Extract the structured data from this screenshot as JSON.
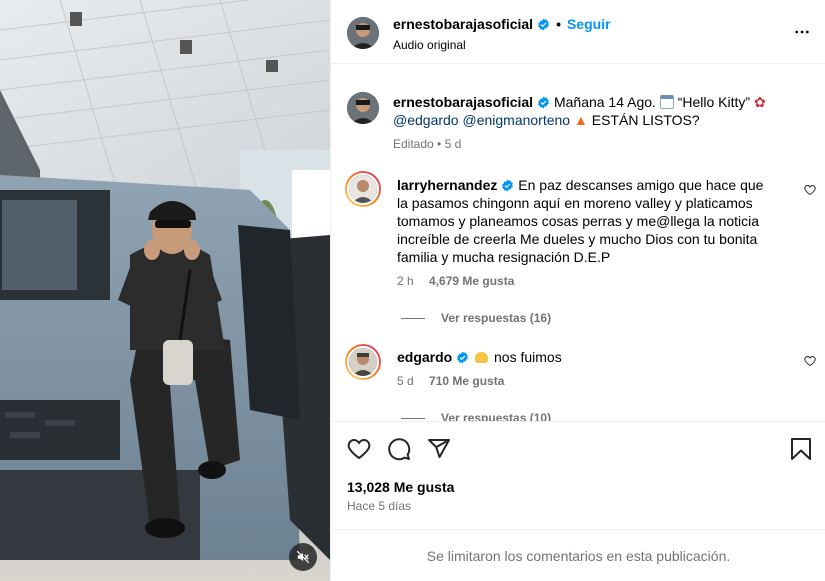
{
  "post": {
    "author": "ernestobarajasoficial",
    "follow_label": "Seguir",
    "audio_label": "Audio original"
  },
  "caption": {
    "author": "ernestobarajasoficial",
    "text_part1": "Mañana 14 Ago.",
    "text_part2": "“Hello Kitty”",
    "mention1": "@edgardo",
    "mention2": "@enigmanorteno",
    "text_part3": "ESTÁN LISTOS?",
    "edited_label": "Editado",
    "time": "5 d"
  },
  "comments": [
    {
      "author": "larryhernandez",
      "text": "En paz descanses amigo que hace que la pasamos chingonn aquí en moreno valley y platicamos tomamos y planeamos cosas perras y me@llega la noticia increíble de creerla Me dueles y mucho Dios con tu bonita familia y mucha resignación D.E.P",
      "time": "2 h",
      "likes": "4,679 Me gusta",
      "replies_label": "Ver respuestas (16)"
    },
    {
      "author": "edgardo",
      "text": "nos fuimos",
      "time": "5 d",
      "likes": "710 Me gusta",
      "replies_label": "Ver respuestas (10)"
    }
  ],
  "stats": {
    "likes": "13,028 Me gusta",
    "posted": "Hace 5 días"
  },
  "footer": {
    "limited_notice": "Se limitaron los comentarios en esta publicación."
  },
  "icons": {
    "like": "heart-icon",
    "comment": "comment-icon",
    "share": "share-icon",
    "save": "bookmark-icon",
    "more": "more-options-icon",
    "mute": "muted-speaker-icon",
    "verified": "verified-badge-icon",
    "calendar": "calendar-emoji",
    "rose": "rose-emoji",
    "fire": "fire-emoji",
    "pray": "raised-hands-emoji"
  },
  "colors": {
    "accent": "#0095f6",
    "verified": "#0095f6",
    "muted_text": "#737373",
    "mention": "#00376b",
    "story_ring_start": "#feda75",
    "story_ring_end": "#d62976"
  }
}
